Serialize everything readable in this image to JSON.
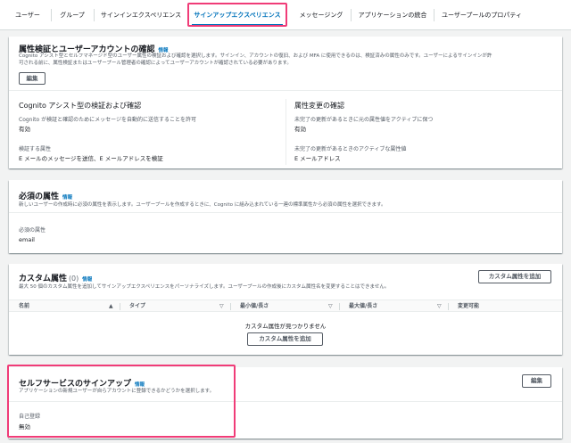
{
  "tabs": [
    {
      "label": "ユーザー"
    },
    {
      "label": "グループ"
    },
    {
      "label": "サインインエクスペリエンス"
    },
    {
      "label": "サインアップエクスペリエンス"
    },
    {
      "label": "メッセージング"
    },
    {
      "label": "アプリケーションの統合"
    },
    {
      "label": "ユーザープールのプロパティ"
    }
  ],
  "verification": {
    "title": "属性検証とユーザーアカウントの確認",
    "info": "情報",
    "desc1": "Cognito アシスト型とセルフマネージド型のユーザー属性の検証および確認を選択します。サインイン、アカウントの復旧、および MFA に使用できるのは、検証済みの属性のみです。ユーザーによるサインインが許",
    "desc2": "可される前に、属性検証またはユーザープール管理者の確認によってユーザーアカウントが確認されている必要があります。",
    "edit_label": "編集",
    "left_heading": "Cognito アシスト型の検証および確認",
    "left_lbl1": "Cognito が検証と確認のためにメッセージを自動的に送信することを許可",
    "left_val1": "有効",
    "left_lbl2": "検証する属性",
    "left_val2": "E メールのメッセージを送信、E メールアドレスを検証",
    "right_heading": "属性変更の確認",
    "right_lbl1": "未完了の更新があるときに元の属性値をアクティブに保つ",
    "right_val1": "有効",
    "right_lbl2": "未完了の更新があるときのアクティブな属性値",
    "right_val2": "E メールアドレス"
  },
  "required": {
    "title": "必須の属性",
    "info": "情報",
    "desc": "新しいユーザーの作成時に必須の属性を表示します。ユーザープールを作成するときに、Cognito に組み込まれている一連の標準属性から必須の属性を選択できます。",
    "lbl": "必須の属性",
    "val": "email"
  },
  "custom": {
    "title": "カスタム属性",
    "count": "(0)",
    "info": "情報",
    "desc": "最大 50 個のカスタム属性を追加してサインアップエクスペリエンスをパーソナライズします。ユーザープールの作成後にカスタム属性名を変更することはできません。",
    "add_label": "カスタム属性を追加",
    "columns": [
      "名前",
      "タイプ",
      "最小値/長さ",
      "最大値/長さ",
      "変更可能"
    ],
    "empty": "カスタム属性が見つかりません",
    "add_center_label": "カスタム属性を追加"
  },
  "selfservice": {
    "title": "セルフサービスのサインアップ",
    "info": "情報",
    "desc": "アプリケーションの新規ユーザーが自らアカウントに登録できるかどうかを選択します。",
    "edit_label": "編集",
    "lbl": "自己登録",
    "val": "無効"
  },
  "colors": {
    "accent": "#0073bb",
    "highlight": "#f03c78"
  }
}
